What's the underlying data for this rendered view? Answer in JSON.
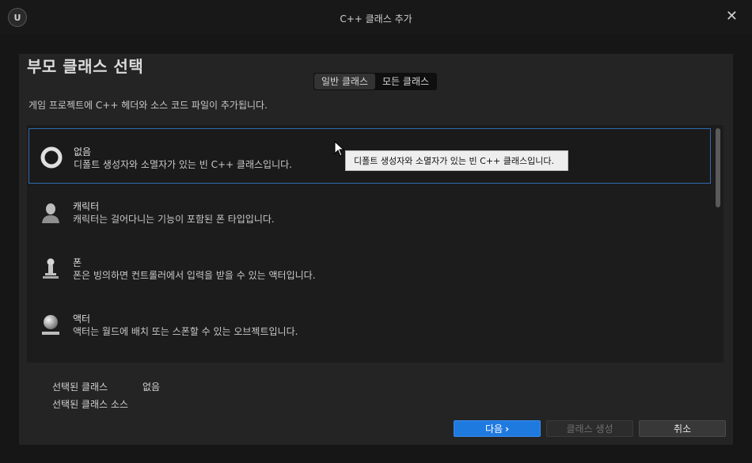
{
  "window": {
    "title": "C++ 클래스 추가",
    "logo_text": "U",
    "close_icon": "close-icon"
  },
  "header": {
    "heading": "부모 클래스 선택",
    "description": "게임 프로젝트에 C++ 헤더와 소스 코드 파일이 추가됩니다."
  },
  "tabs": [
    {
      "label": "일반 클래스",
      "active": true
    },
    {
      "label": "모든 클래스",
      "active": false
    }
  ],
  "classes": [
    {
      "name": "없음",
      "desc": "디폴트 생성자와 소멸자가 있는 빈 C++ 클래스입니다.",
      "icon": "ring-icon",
      "selected": true
    },
    {
      "name": "캐릭터",
      "desc": "캐릭터는 걸어다니는 기능이 포함된 폰 타입입니다.",
      "icon": "character-icon",
      "selected": false
    },
    {
      "name": "폰",
      "desc": "폰은 빙의하면 컨트롤러에서 입력을 받을 수 있는 액터입니다.",
      "icon": "pawn-icon",
      "selected": false
    },
    {
      "name": "액터",
      "desc": "액터는 월드에 배치 또는 스폰할 수 있는 오브젝트입니다.",
      "icon": "actor-icon",
      "selected": false
    }
  ],
  "tooltip": "디폴트 생성자와 소멸자가 있는 빈 C++ 클래스입니다.",
  "summary": {
    "selected_label": "선택된 클래스",
    "selected_value": "없음",
    "source_label": "선택된 클래스 소스",
    "source_value": ""
  },
  "buttons": {
    "next": "다음",
    "next_icon": "chevron-right-icon",
    "create": "클래스 생성",
    "cancel": "취소"
  },
  "colors": {
    "accent": "#1f7ae0",
    "selection_border": "#2f6cb0",
    "panel": "#242424",
    "background": "#161616"
  }
}
